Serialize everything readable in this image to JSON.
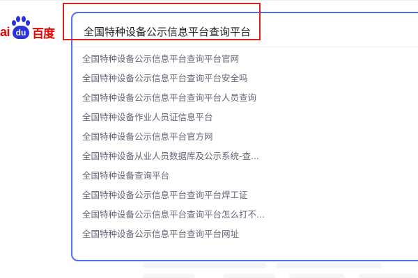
{
  "logo": {
    "text_ai": "ai",
    "text_du": "du",
    "text_cn": "百度"
  },
  "search": {
    "query": "全国特种设备公示信息平台查询平台"
  },
  "suggestions": [
    "全国特种设备公示信息平台查询平台官网",
    "全国特种设备公示信息平台查询平台安全吗",
    "全国特种设备公示信息平台查询平台人员查询",
    "全国特种设备作业人员证信息平台",
    "全国特种设备公示信息平台官方网",
    "全国特种设备从业人员数据库及公示系统-查...",
    "全国特种设备查询平台",
    "全国特种设备公示信息平台查询平台焊工证",
    "全国特种设备公示信息平台查询平台怎么打不...",
    "全国特种设备公示信息平台查询平台网址"
  ],
  "colors": {
    "accent_border": "#4e6ef2",
    "highlight": "#e02020",
    "logo_red": "#e10602",
    "logo_blue": "#2932e1"
  }
}
